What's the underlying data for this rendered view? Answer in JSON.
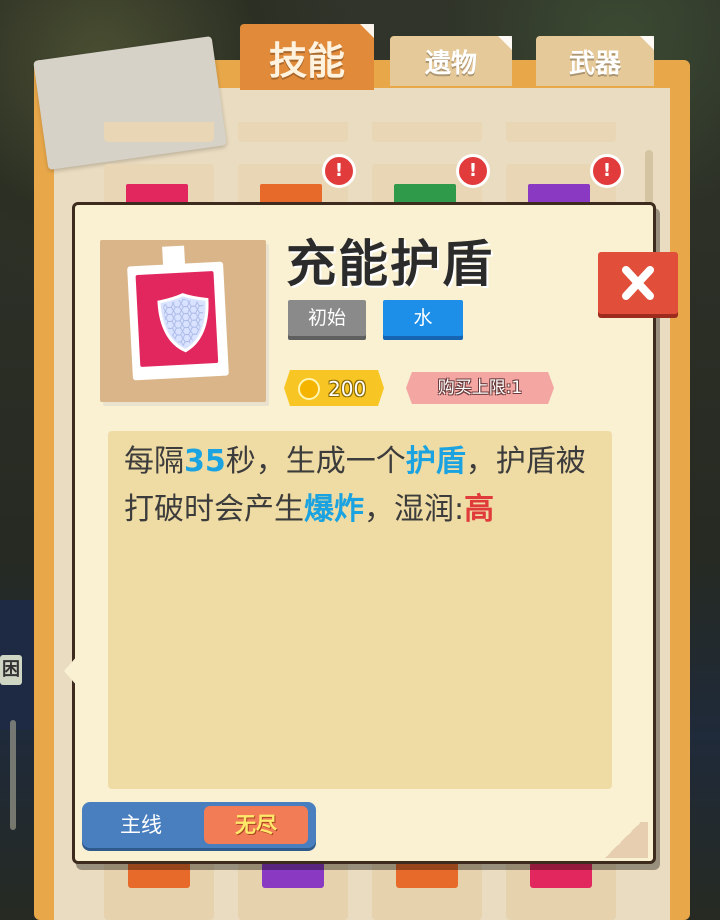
{
  "tabs": [
    {
      "label": "技能",
      "active": true
    },
    {
      "label": "遗物",
      "active": false
    },
    {
      "label": "武器",
      "active": false
    }
  ],
  "background_glyph": "困",
  "grid_alert_icon": "!",
  "detail": {
    "title": "充能护盾",
    "icon": "shield-icon",
    "tags": [
      {
        "label": "初始",
        "color": "#8a8a8a"
      },
      {
        "label": "水",
        "color": "#1e8fe8"
      }
    ],
    "price": "200",
    "purchase_limit": "购买上限:1",
    "description": {
      "p1": "每隔",
      "n1": "35",
      "p2": "秒，生成一个",
      "k1": "护盾",
      "p3": "，护盾被打破时会产生",
      "k2": "爆炸",
      "p4": "，湿润:",
      "k3": "高"
    }
  },
  "mode_toggle": {
    "options": [
      "主线",
      "无尽"
    ],
    "selected": "无尽"
  },
  "colors": {
    "accent_orange": "#e08a3a",
    "keyword_blue": "#1aa3e0",
    "keyword_red": "#e03a3a",
    "close_red": "#e14e3a"
  }
}
